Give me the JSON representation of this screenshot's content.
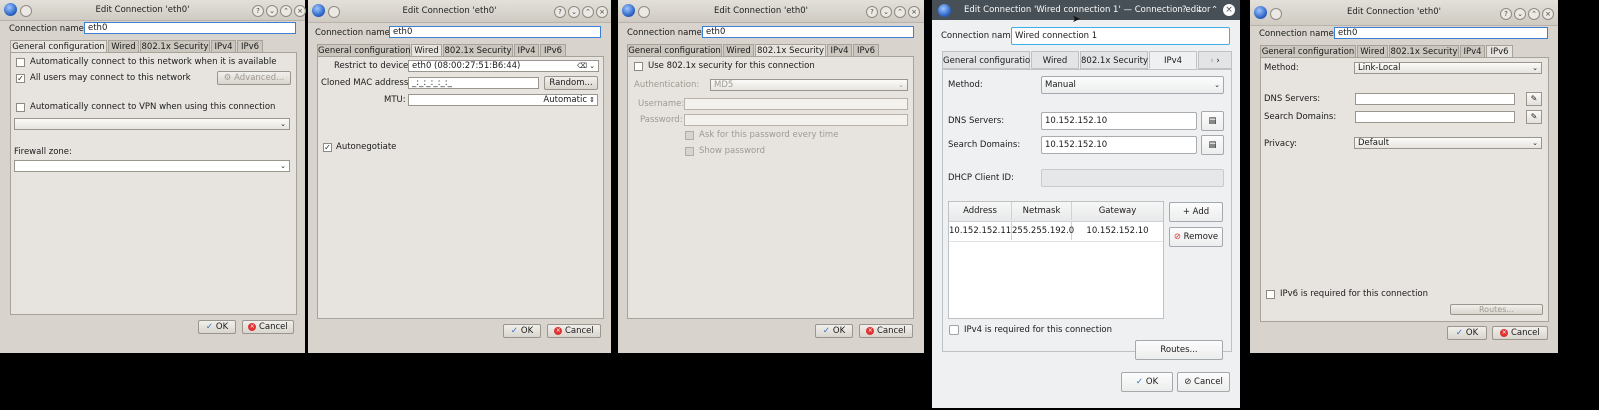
{
  "common": {
    "window_title": "Edit Connection 'eth0'",
    "connection_name_label": "Connection name:",
    "connection_name_value": "eth0",
    "tabs": [
      "General configuration",
      "Wired",
      "802.1x Security",
      "IPv4",
      "IPv6"
    ],
    "ok_label": "OK",
    "cancel_label": "Cancel"
  },
  "general": {
    "auto_connect_label": "Automatically connect to this network when it is available",
    "all_users_label": "All users may connect to this network",
    "advanced_label": "Advanced...",
    "vpn_label": "Automatically connect to VPN when using this connection",
    "firewall_label": "Firewall zone:"
  },
  "wired": {
    "restrict_label": "Restrict to device:",
    "restrict_value": "eth0 (08:00:27:51:B6:44)",
    "cloned_label": "Cloned MAC address:",
    "cloned_value": "_:_:_:_:_:_",
    "random_label": "Random...",
    "mtu_label": "MTU:",
    "mtu_value": "Automatic",
    "autoneg_label": "Autonegotiate"
  },
  "security": {
    "use_label": "Use 802.1x security for this connection",
    "auth_label": "Authentication:",
    "auth_value": "MD5",
    "username_label": "Username:",
    "password_label": "Password:",
    "ask_label": "Ask for this password every time",
    "show_label": "Show password"
  },
  "ipv4": {
    "window_title": "Edit Connection 'Wired connection 1' — Connection editor",
    "connection_name_value": "Wired connection 1",
    "method_label": "Method:",
    "method_value": "Manual",
    "dns_label": "DNS Servers:",
    "dns_value": "10.152.152.10",
    "search_label": "Search Domains:",
    "search_value": "10.152.152.10",
    "dhcp_label": "DHCP Client ID:",
    "columns": [
      "Address",
      "Netmask",
      "Gateway"
    ],
    "row": [
      "10.152.152.11",
      "255.255.192.0",
      "10.152.152.10"
    ],
    "add_label": "Add",
    "remove_label": "Remove",
    "required_label": "IPv4 is required for this connection",
    "routes_label": "Routes..."
  },
  "ipv6": {
    "method_label": "Method:",
    "method_value": "Link-Local",
    "dns_label": "DNS Servers:",
    "search_label": "Search Domains:",
    "privacy_label": "Privacy:",
    "privacy_value": "Default",
    "required_label": "IPv6 is required for this connection",
    "routes_label": "Routes..."
  }
}
